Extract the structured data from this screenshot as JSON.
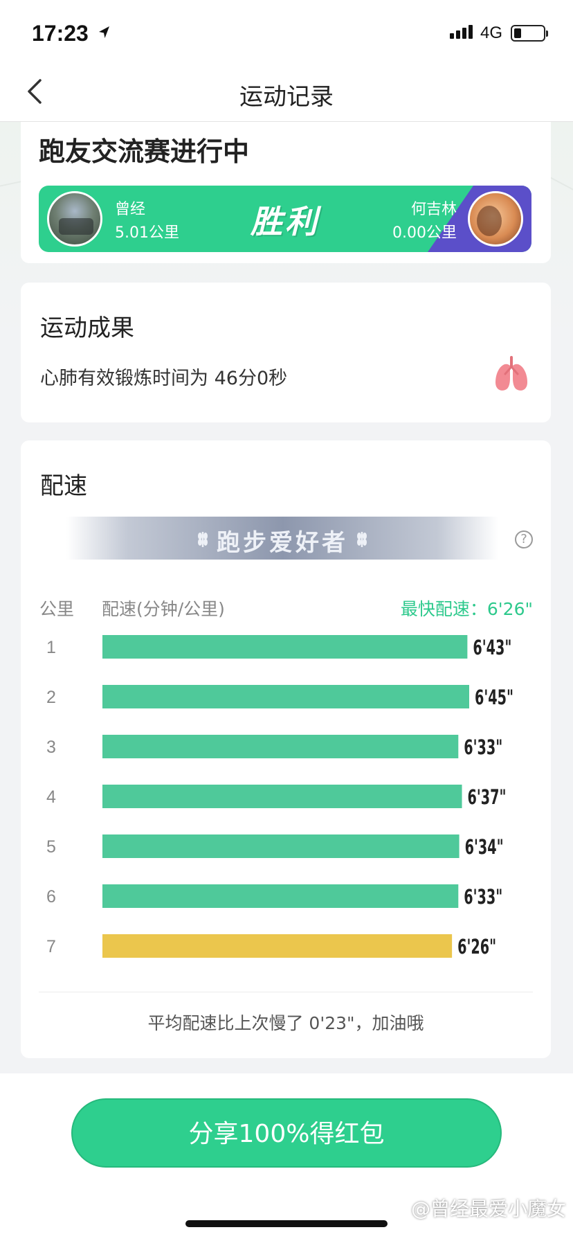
{
  "status_bar": {
    "time": "17:23",
    "network": "4G"
  },
  "nav": {
    "title": "运动记录"
  },
  "match": {
    "title": "跑友交流赛进行中",
    "result": "胜利",
    "left_player": {
      "name": "曾经",
      "distance": "5.01公里"
    },
    "right_player": {
      "name": "何吉林",
      "distance": "0.00公里"
    }
  },
  "result_card": {
    "heading": "运动成果",
    "text": "心肺有效锻炼时间为 46分0秒"
  },
  "pace_card": {
    "heading": "配速",
    "badge": "跑步爱好者",
    "help": "?",
    "col_km": "公里",
    "col_pace": "配速(分钟/公里)",
    "fastest": "最快配速：6'26\"",
    "summary": "平均配速比上次慢了 0'23\"，加油哦"
  },
  "colors": {
    "accent": "#2ecf8e",
    "bar": "#4fc99a",
    "fastest_bar": "#ebc64d",
    "opponent": "#5b4fc9"
  },
  "chart_data": {
    "type": "bar",
    "orientation": "horizontal",
    "categories": [
      "1",
      "2",
      "3",
      "4",
      "5",
      "6",
      "7"
    ],
    "labels": [
      "6'43\"",
      "6'45\"",
      "6'33\"",
      "6'37\"",
      "6'34\"",
      "6'33\"",
      "6'26\""
    ],
    "values": [
      403,
      405,
      393,
      397,
      394,
      393,
      386
    ],
    "highlight_index": 6,
    "xlim": [
      0,
      405
    ]
  },
  "share_button": {
    "label": "分享100%得红包"
  },
  "watermark": "@曾经最爱小魔女"
}
